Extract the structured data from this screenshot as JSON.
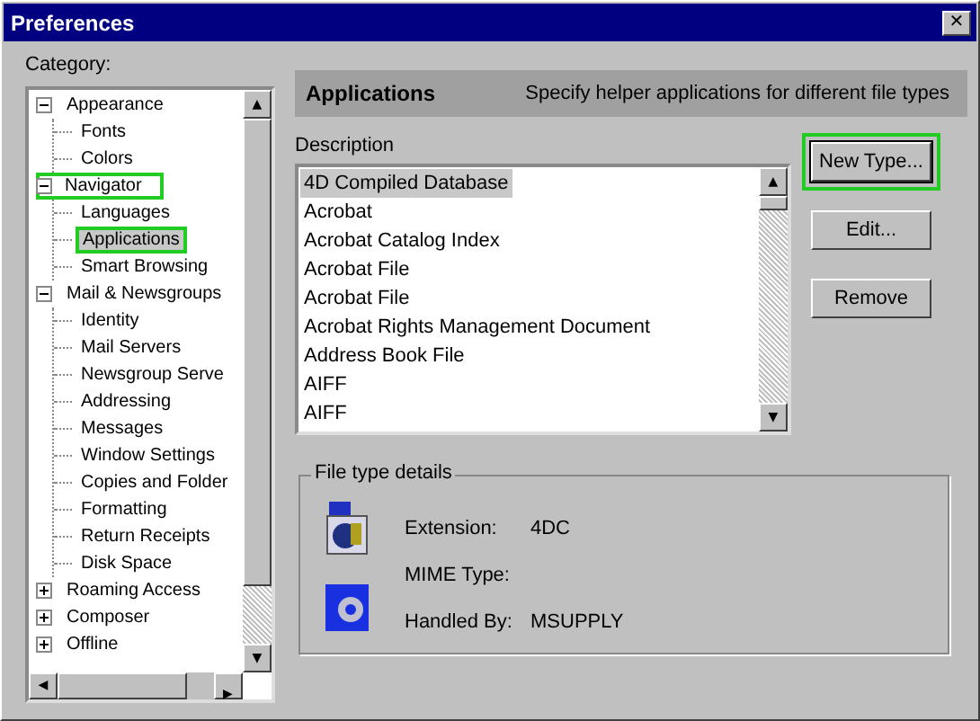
{
  "window": {
    "title": "Preferences",
    "close_glyph": "✕"
  },
  "scroll_arrows": {
    "up": "▲",
    "down": "▼",
    "left": "◀",
    "right": "▶"
  },
  "category_label": "Category:",
  "tree": [
    {
      "label": "Appearance",
      "expanded": true,
      "selected": false,
      "highlighted": false,
      "children": [
        {
          "label": "Fonts",
          "selected": false,
          "highlighted": false
        },
        {
          "label": "Colors",
          "selected": false,
          "highlighted": false
        }
      ]
    },
    {
      "label": "Navigator",
      "expanded": true,
      "selected": false,
      "highlighted": true,
      "children": [
        {
          "label": "Languages",
          "selected": false,
          "highlighted": false
        },
        {
          "label": "Applications",
          "selected": true,
          "highlighted": true
        },
        {
          "label": "Smart Browsing",
          "selected": false,
          "highlighted": false
        }
      ]
    },
    {
      "label": "Mail & Newsgroups",
      "expanded": true,
      "selected": false,
      "highlighted": false,
      "children": [
        {
          "label": "Identity",
          "selected": false,
          "highlighted": false
        },
        {
          "label": "Mail Servers",
          "selected": false,
          "highlighted": false
        },
        {
          "label": "Newsgroup Serve",
          "selected": false,
          "highlighted": false
        },
        {
          "label": "Addressing",
          "selected": false,
          "highlighted": false
        },
        {
          "label": "Messages",
          "selected": false,
          "highlighted": false
        },
        {
          "label": "Window Settings",
          "selected": false,
          "highlighted": false
        },
        {
          "label": "Copies and Folder",
          "selected": false,
          "highlighted": false
        },
        {
          "label": "Formatting",
          "selected": false,
          "highlighted": false
        },
        {
          "label": "Return Receipts",
          "selected": false,
          "highlighted": false
        },
        {
          "label": "Disk Space",
          "selected": false,
          "highlighted": false
        }
      ]
    },
    {
      "label": "Roaming Access",
      "expanded": false,
      "selected": false,
      "highlighted": false
    },
    {
      "label": "Composer",
      "expanded": false,
      "selected": false,
      "highlighted": false
    },
    {
      "label": "Offline",
      "expanded": false,
      "selected": false,
      "highlighted": false
    }
  ],
  "panel": {
    "title": "Applications",
    "subtitle": "Specify helper applications for different file types"
  },
  "description_label": "Description",
  "file_types": [
    {
      "label": "4D Compiled Database",
      "selected": true
    },
    {
      "label": "Acrobat",
      "selected": false
    },
    {
      "label": "Acrobat Catalog Index",
      "selected": false
    },
    {
      "label": "Acrobat File",
      "selected": false
    },
    {
      "label": "Acrobat File",
      "selected": false
    },
    {
      "label": "Acrobat Rights Management Document",
      "selected": false
    },
    {
      "label": "Address Book File",
      "selected": false
    },
    {
      "label": "AIFF",
      "selected": false
    },
    {
      "label": "AIFF",
      "selected": false
    }
  ],
  "buttons": [
    {
      "label": "New Type...",
      "highlighted": true
    },
    {
      "label": "Edit...",
      "highlighted": false
    },
    {
      "label": "Remove",
      "highlighted": false
    }
  ],
  "details": {
    "title": "File type details",
    "fields": [
      {
        "label": "Extension:",
        "value": "4DC"
      },
      {
        "label": "MIME Type:"
      },
      {
        "label": "Handled By:",
        "value": "MSUPPLY"
      }
    ]
  }
}
